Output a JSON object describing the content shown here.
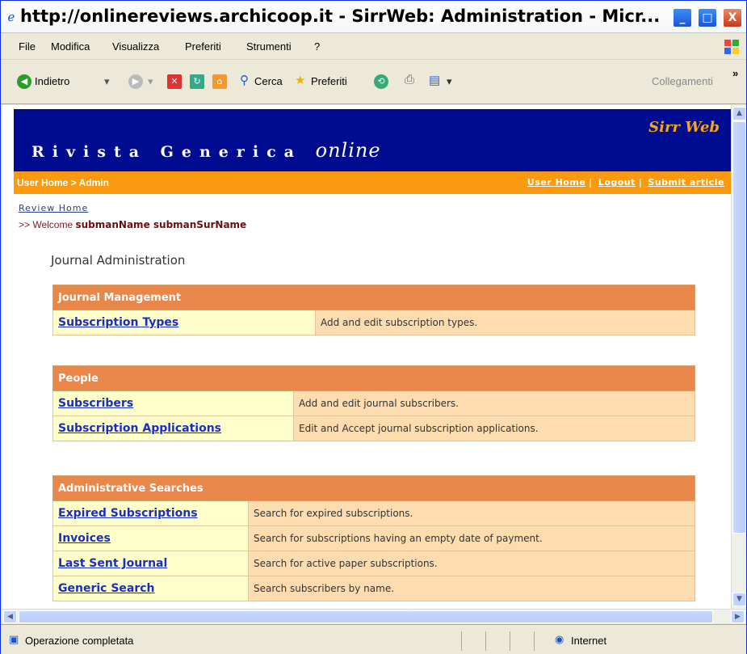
{
  "window": {
    "title": "http://onlinereviews.archicoop.it - SirrWeb: Administration - Micr...",
    "min_glyph": "_",
    "max_glyph": "□",
    "close_glyph": "X"
  },
  "menubar": [
    "File",
    "Modifica",
    "Visualizza",
    "Preferiti",
    "Strumenti",
    "?"
  ],
  "toolbar": {
    "back": "Indietro",
    "search": "Cerca",
    "favorites": "Preferiti",
    "links": "Collegamenti"
  },
  "page": {
    "banner_brand": "Sirr Web",
    "banner_title": "Rivista Generica",
    "banner_online": "online",
    "breadcrumb": "User Home > Admin",
    "nav_links": [
      "User Home",
      "Logout",
      "Submit article"
    ],
    "review_home": "Review Home",
    "welcome_prefix": ">> Welcome",
    "welcome_name": "submanName submanSurName",
    "admin_title": "Journal Administration"
  },
  "sections": [
    {
      "header": "Journal Management",
      "rows": [
        {
          "name": "Subscription Types",
          "desc": "Add and edit subscription types."
        }
      ]
    },
    {
      "header": "People",
      "rows": [
        {
          "name": "Subscribers",
          "desc": "Add and edit journal subscribers."
        },
        {
          "name": "Subscription Applications",
          "desc": "Edit and Accept journal subscription applications."
        }
      ]
    },
    {
      "header": "Administrative Searches",
      "rows": [
        {
          "name": "Expired Subscriptions",
          "desc": "Search for expired subscriptions."
        },
        {
          "name": "Invoices",
          "desc": "Search for subscriptions having an empty date of payment."
        },
        {
          "name": "Last Sent Journal",
          "desc": "Search for active paper subscriptions."
        },
        {
          "name": "Generic Search",
          "desc": "Search subscribers by name."
        }
      ]
    }
  ],
  "status": {
    "text": "Operazione completata",
    "zone": "Internet"
  },
  "colors": {
    "banner": "#000c8f",
    "nav_bar": "#fb9a11",
    "section_header": "#e9864a",
    "name_cell": "#ffffcc",
    "desc_cell": "#fddcb0"
  }
}
